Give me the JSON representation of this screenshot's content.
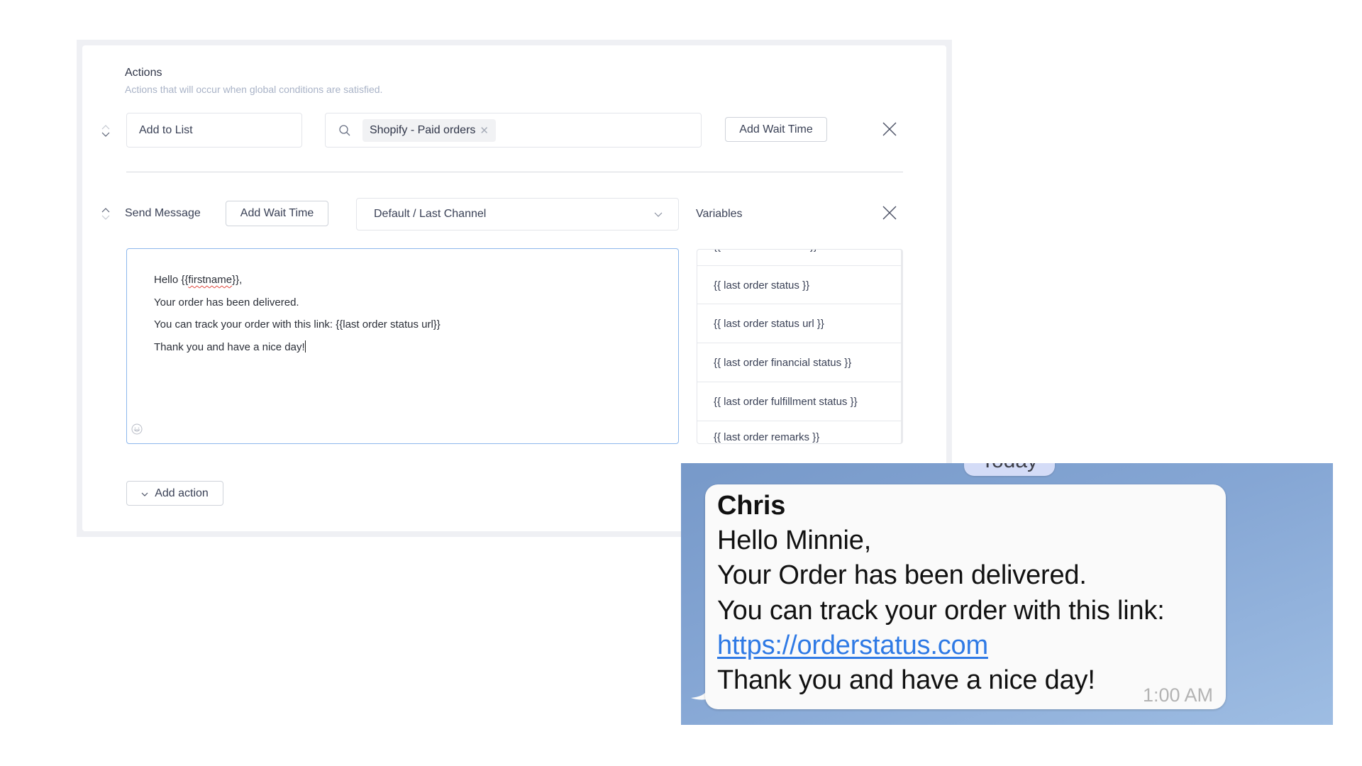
{
  "actions_section": {
    "title": "Actions",
    "subtitle": "Actions that will occur when global conditions are satisfied."
  },
  "action_rows": [
    {
      "type_label": "Add to List",
      "search_chip": "Shopify - Paid orders",
      "wait_button": "Add Wait Time"
    },
    {
      "type_label": "Send Message",
      "wait_button": "Add Wait Time",
      "channel_select": "Default / Last Channel",
      "variables_label": "Variables"
    }
  ],
  "message_editor": {
    "lines": [
      "Hello ",
      "Your order has been delivered.",
      "You can track your order with this link: {{last order status url}}",
      "Thank you and have a nice day!"
    ],
    "firstname_open": "{{",
    "firstname_var": "firstname",
    "firstname_close": "}},"
  },
  "variables": [
    "{{ last order number }}",
    "{{ last order status }}",
    "{{ last order status url }}",
    "{{ last order financial status }}",
    "{{ last order fulfillment status }}",
    "{{ last order remarks }}"
  ],
  "add_action_button": "Add action",
  "chat_preview": {
    "date_pill": "Today",
    "sender": "Chris",
    "lines": [
      "Hello Minnie,",
      "Your Order has been delivered.",
      "You can track your order with this link:"
    ],
    "link": "https://orderstatus.com",
    "closing": "Thank you and have a nice day!",
    "time": "1:00 AM"
  },
  "colors": {
    "accent_focus": "#8db7ec",
    "link": "#2f7ae5",
    "chat_background": "#7f9fcf"
  }
}
